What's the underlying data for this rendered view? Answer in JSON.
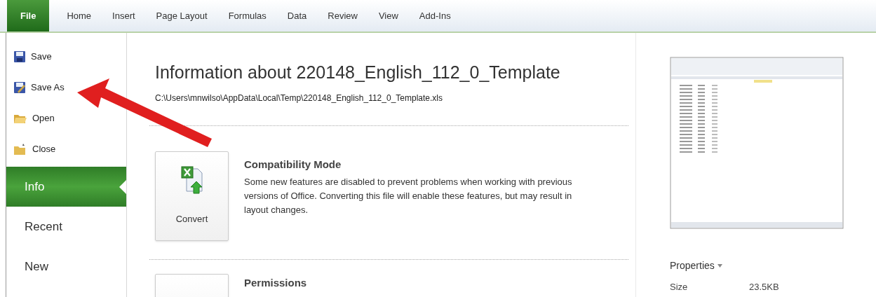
{
  "ribbon_tabs": [
    {
      "label": "File",
      "selected": true
    },
    {
      "label": "Home",
      "selected": false
    },
    {
      "label": "Insert",
      "selected": false
    },
    {
      "label": "Page Layout",
      "selected": false
    },
    {
      "label": "Formulas",
      "selected": false
    },
    {
      "label": "Data",
      "selected": false
    },
    {
      "label": "Review",
      "selected": false
    },
    {
      "label": "View",
      "selected": false
    },
    {
      "label": "Add-Ins",
      "selected": false
    }
  ],
  "backstage_menu": [
    {
      "label": "Save",
      "kind": "command",
      "selected": false
    },
    {
      "label": "Save As",
      "kind": "command",
      "selected": false
    },
    {
      "label": "Open",
      "kind": "command",
      "selected": false
    },
    {
      "label": "Close",
      "kind": "command",
      "selected": false
    },
    {
      "label": "Info",
      "kind": "tab",
      "selected": true
    },
    {
      "label": "Recent",
      "kind": "tab",
      "selected": false
    },
    {
      "label": "New",
      "kind": "tab",
      "selected": false
    }
  ],
  "info": {
    "title": "Information about 220148_English_112_0_Template",
    "path": "C:\\Users\\mnwilso\\AppData\\Local\\Temp\\220148_English_112_0_Template.xls",
    "sections": [
      {
        "button_label": "Convert",
        "heading": "Compatibility Mode",
        "description": "Some new features are disabled to prevent problems when working with previous versions of Office. Converting this file will enable these features, but may result in layout changes."
      },
      {
        "heading": "Permissions"
      }
    ]
  },
  "properties": {
    "heading": "Properties",
    "rows": [
      {
        "label": "Size",
        "value": "23.5KB"
      }
    ]
  }
}
